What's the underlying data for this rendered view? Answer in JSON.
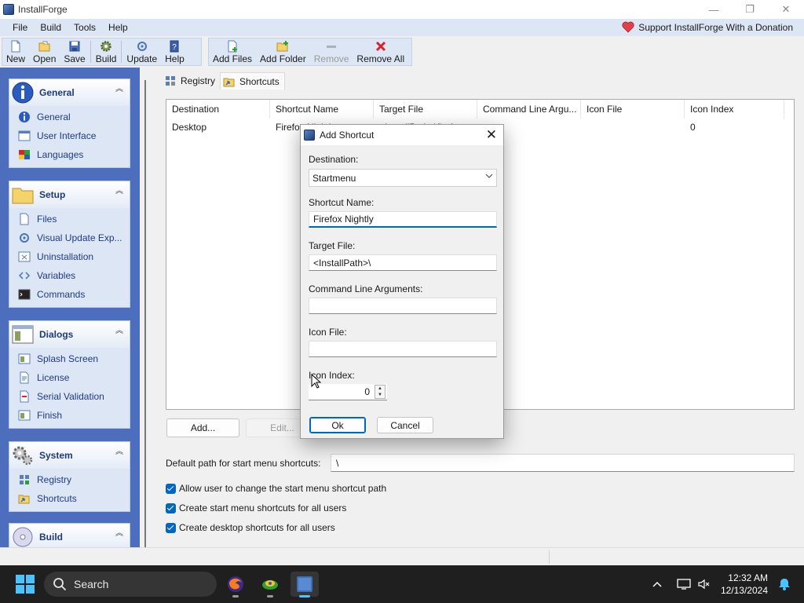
{
  "window": {
    "title": "InstallForge",
    "minimize_icon": "—",
    "maximize_icon": "❐",
    "close_icon": "✕"
  },
  "menubar": {
    "items": [
      "File",
      "Build",
      "Tools",
      "Help"
    ],
    "donate_label": "Support InstallForge With a Donation"
  },
  "toolbar": {
    "new": "New",
    "open": "Open",
    "save": "Save",
    "build": "Build",
    "update": "Update",
    "help": "Help",
    "add_files": "Add Files",
    "add_folder": "Add Folder",
    "remove": "Remove",
    "remove_all": "Remove All"
  },
  "sidebar": {
    "panels": [
      {
        "title": "General",
        "items": [
          "General",
          "User Interface",
          "Languages"
        ]
      },
      {
        "title": "Setup",
        "items": [
          "Files",
          "Visual Update Exp...",
          "Uninstallation",
          "Variables",
          "Commands"
        ]
      },
      {
        "title": "Dialogs",
        "items": [
          "Splash Screen",
          "License",
          "Serial Validation",
          "Finish"
        ]
      },
      {
        "title": "System",
        "items": [
          "Registry",
          "Shortcuts"
        ]
      },
      {
        "title": "Build",
        "items": []
      }
    ],
    "collapse_glyph": "︽"
  },
  "tabs": [
    {
      "label": "Registry",
      "active": false
    },
    {
      "label": "Shortcuts",
      "active": true
    }
  ],
  "listview": {
    "columns": [
      "Destination",
      "Shortcut Name",
      "Target File",
      "Command Line Argu...",
      "Icon File",
      "Icon Index"
    ],
    "rows": [
      [
        "Desktop",
        "Firefox Nightly",
        "<InstallPath>\\firefox.exe",
        "",
        "",
        "0"
      ]
    ]
  },
  "buttons": {
    "add": "Add...",
    "edit": "Edit..."
  },
  "start_menu_path": {
    "label": "Default path for start menu shortcuts:",
    "value": "\\"
  },
  "options": [
    {
      "label": "Allow user to change the start menu shortcut path",
      "checked": true
    },
    {
      "label": "Create start menu shortcuts for all users",
      "checked": true
    },
    {
      "label": "Create desktop shortcuts for all users",
      "checked": true
    }
  ],
  "dialog": {
    "title": "Add Shortcut",
    "close_glyph": "✕",
    "destination_label": "Destination:",
    "destination_value": "Startmenu",
    "shortcut_name_label": "Shortcut Name:",
    "shortcut_name_value": "Firefox Nightly",
    "target_file_label": "Target File:",
    "target_file_value": "<InstallPath>\\",
    "cmd_args_label": "Command Line Arguments:",
    "cmd_args_value": "",
    "icon_file_label": "Icon File:",
    "icon_file_value": "",
    "icon_index_label": "Icon Index:",
    "icon_index_value": "0",
    "ok": "Ok",
    "cancel": "Cancel"
  },
  "taskbar": {
    "search_label": "Search",
    "time": "12:32 AM",
    "date": "12/13/2024",
    "apps": [
      "firefox-nightly-icon",
      "installer-app-icon",
      "installforge-icon"
    ]
  },
  "colors": {
    "accent": "#0067c0",
    "sidebar_bg": "#4c6ebd",
    "panel_bg": "#dde6f4",
    "taskbar_bg": "#1f1f1f"
  }
}
